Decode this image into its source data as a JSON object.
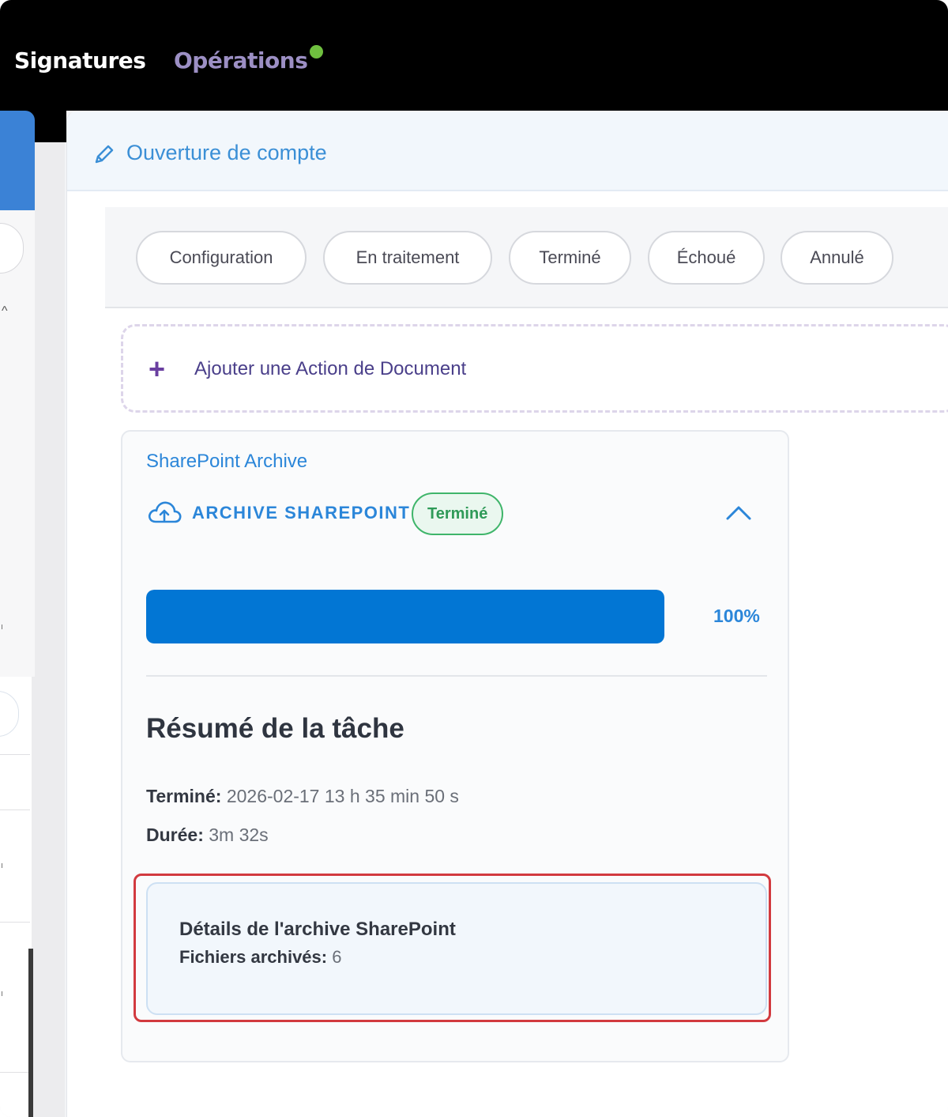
{
  "nav": {
    "items": [
      {
        "label": "Signatures"
      },
      {
        "label": "Opérations"
      }
    ],
    "status_dot_color": "#6fbf3f"
  },
  "header": {
    "icon": "pencil-icon",
    "title": "Ouverture de compte"
  },
  "tabs": [
    {
      "label": "Configuration"
    },
    {
      "label": "En traitement"
    },
    {
      "label": "Terminé"
    },
    {
      "label": "Échoué"
    },
    {
      "label": "Annulé"
    }
  ],
  "add_action": {
    "icon": "plus-icon",
    "label": "Ajouter une Action de Document"
  },
  "card": {
    "title": "SharePoint Archive",
    "task": {
      "icon": "cloud-upload-icon",
      "name": "ARCHIVE SHAREPOINT",
      "status": "Terminé",
      "status_color": "#2f9a58"
    },
    "progress": {
      "fraction": 1.0,
      "label": "100%",
      "color": "#0276d4"
    },
    "summary": {
      "title": "Résumé de la tâche",
      "completed_label": "Terminé:",
      "completed_value": "2026-02-17 13 h 35 min 50 s",
      "duration_label": "Durée:",
      "duration_value": "3m 32s"
    },
    "details": {
      "title": "Détails de l'archive SharePoint",
      "files_label": "Fichiers archivés:",
      "files_value": "6"
    }
  },
  "accent_color": "#2b86d9",
  "highlight_color": "#d23a3f"
}
